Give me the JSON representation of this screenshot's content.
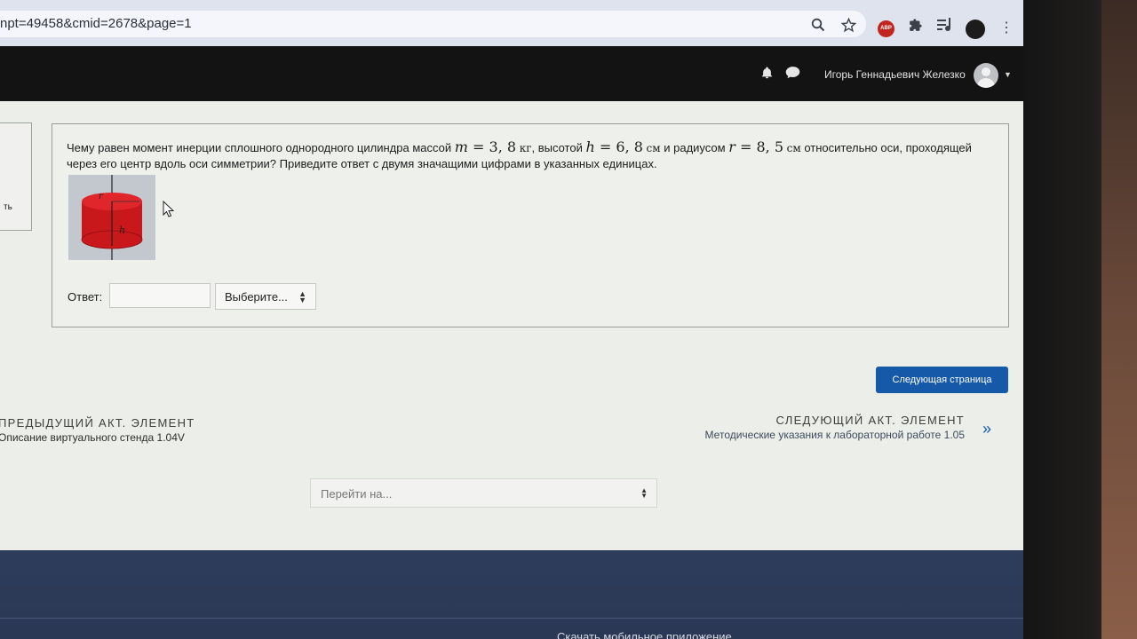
{
  "browser": {
    "url": "npt=49458&cmid=2678&page=1",
    "icons": [
      "search-icon",
      "star-icon",
      "adblock-icon",
      "extensions-icon",
      "media-icon",
      "profile-icon",
      "menu-icon"
    ],
    "abp_label": "ABP"
  },
  "header": {
    "user_name": "Игорь Геннадьевич Железко",
    "icons": [
      "bell-icon",
      "chat-icon",
      "avatar",
      "chevron-down-icon"
    ]
  },
  "left_panel": {
    "label": "ть"
  },
  "question": {
    "text_1": "Чему равен момент инерции сплошного однородного цилиндра массой",
    "m_var": "m",
    "m_val": "3, 8",
    "m_unit": "кг",
    "text_2": ", высотой",
    "h_var": "h",
    "h_val": "6, 8",
    "h_unit": "см",
    "text_3": "и радиусом",
    "r_var": "r",
    "r_val": "8, 5",
    "r_unit": "см",
    "text_4": "относительно оси, проходящей через его центр вдоль оси симметрии? Приведите ответ с двумя значащими цифрами в указанных единицах.",
    "figure_labels": {
      "r": "r",
      "h": "h"
    },
    "answer_label": "Ответ:",
    "answer_value": "",
    "unit_select": "Выберите..."
  },
  "navigation": {
    "next_page_button": "Следующая страница",
    "prev_activity_label": "ПРЕДЫДУЩИЙ АКТ. ЭЛЕМЕНТ",
    "prev_activity_link": "Описание виртуального стенда 1.04V",
    "next_activity_label": "СЛЕДУЮЩИЙ АКТ. ЭЛЕМЕНТ",
    "next_activity_link": "Методические указания к лабораторной работе 1.05",
    "jump_select": "Перейти на..."
  },
  "footer": {
    "mobile_app_link": "Скачать мобильное приложение"
  },
  "colors": {
    "accent": "#1559a8",
    "header_bg": "#131313",
    "footer_bg": "#2e3d5b",
    "cylinder": "#c8181b"
  }
}
